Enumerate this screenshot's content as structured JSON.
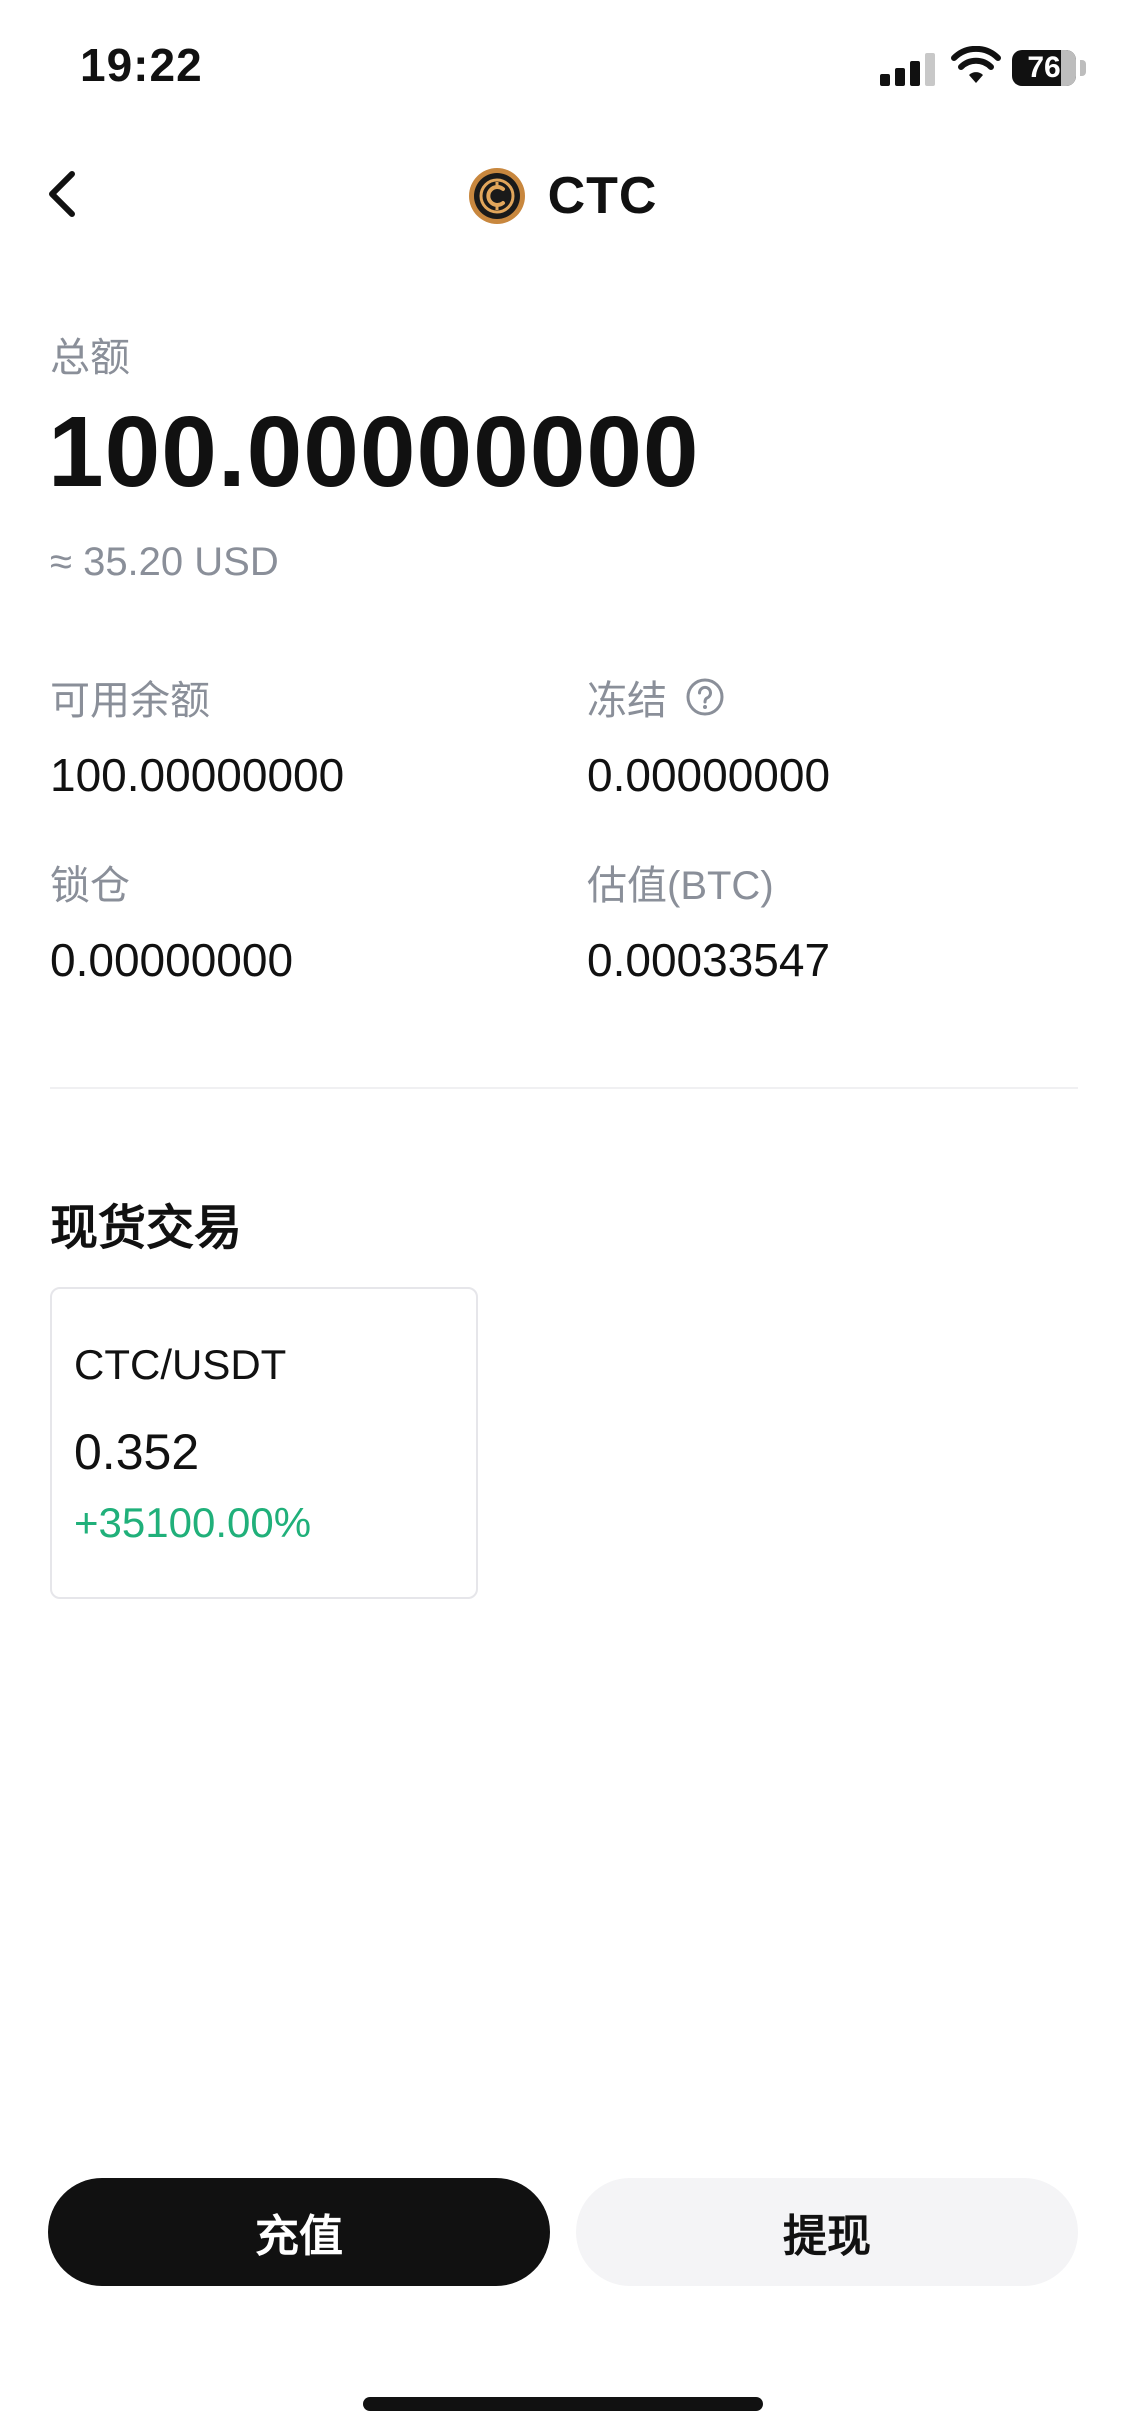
{
  "status_bar": {
    "time": "19:22",
    "battery": "76",
    "battery_level": 0.76
  },
  "header": {
    "title": "CTC",
    "coin_icon": "ctc-coin-icon",
    "back_icon": "chevron-left-icon"
  },
  "totals": {
    "label": "总额",
    "value": "100.00000000",
    "fiat": "≈ 35.20 USD"
  },
  "stats": {
    "available": {
      "label": "可用余额",
      "value": "100.00000000"
    },
    "frozen": {
      "label": "冻结",
      "value": "0.00000000",
      "icon": "question-circle-icon"
    },
    "locked": {
      "label": "锁仓",
      "value": "0.00000000"
    },
    "btc_value": {
      "label": "估值(BTC)",
      "value": "0.00033547"
    }
  },
  "spot": {
    "title": "现货交易",
    "markets": [
      {
        "pair": "CTC/USDT",
        "price": "0.352",
        "change": "+35100.00%"
      }
    ]
  },
  "actions": {
    "deposit": "充值",
    "withdraw": "提现"
  },
  "colors": {
    "primary_button": "#111111",
    "secondary_button": "#f4f4f6",
    "muted_text": "#8a8f99",
    "positive": "#20b07a",
    "coin_ring": "#c8873e"
  }
}
